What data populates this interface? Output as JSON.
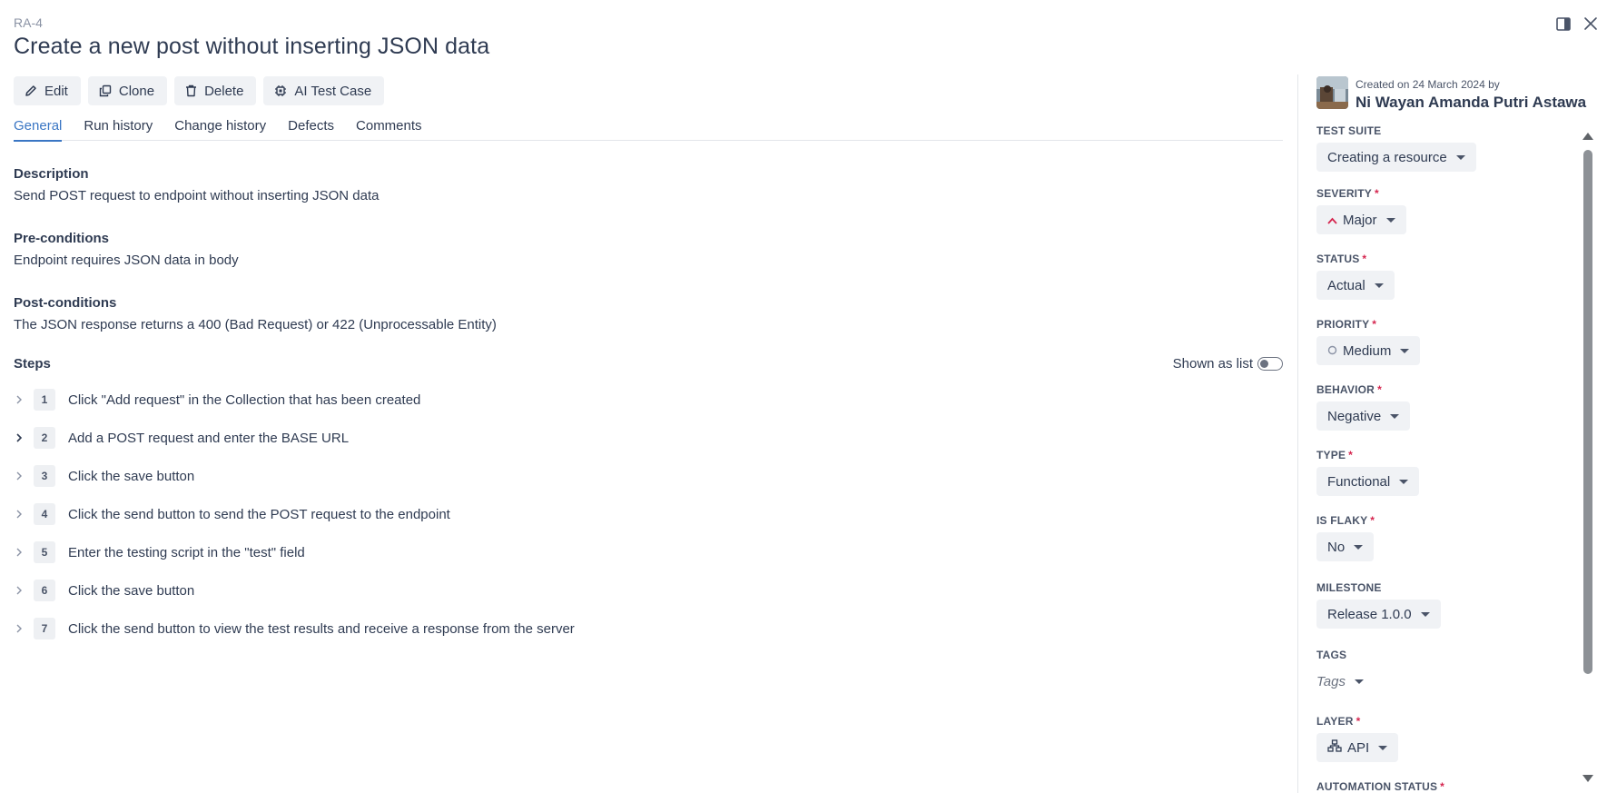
{
  "case": {
    "id": "RA-4",
    "title": "Create a new post without inserting JSON data"
  },
  "toolbar": {
    "edit_label": "Edit",
    "clone_label": "Clone",
    "delete_label": "Delete",
    "ai_label": "AI Test Case"
  },
  "tabs": [
    {
      "label": "General",
      "active": true
    },
    {
      "label": "Run history",
      "active": false
    },
    {
      "label": "Change history",
      "active": false
    },
    {
      "label": "Defects",
      "active": false
    },
    {
      "label": "Comments",
      "active": false
    }
  ],
  "description": {
    "label": "Description",
    "text": "Send POST request to endpoint without inserting JSON data"
  },
  "preconditions": {
    "label": "Pre-conditions",
    "text": "Endpoint requires JSON data in body"
  },
  "postconditions": {
    "label": "Post-conditions",
    "text": "The JSON response returns a 400 (Bad Request) or 422 (Unprocessable Entity)"
  },
  "steps": {
    "label": "Steps",
    "toggle_label": "Shown as list",
    "toggle_on": false,
    "items": [
      {
        "num": "1",
        "text": "Click \"Add request\" in the Collection that has been created"
      },
      {
        "num": "2",
        "text": "Add a POST request and enter the BASE URL"
      },
      {
        "num": "3",
        "text": "Click the save button"
      },
      {
        "num": "4",
        "text": "Click the send button to send the POST request to the endpoint"
      },
      {
        "num": "5",
        "text": "Enter the testing script in the \"test\" field"
      },
      {
        "num": "6",
        "text": "Click the save button"
      },
      {
        "num": "7",
        "text": "Click the send button to view the test results and receive a response from the server"
      }
    ]
  },
  "sidebar": {
    "created_line": "Created on 24 March 2024 by",
    "creator_name": "Ni Wayan Amanda Putri Astawa",
    "fields": {
      "test_suite": {
        "label": "TEST SUITE",
        "value": "Creating a resource",
        "required": false
      },
      "severity": {
        "label": "SEVERITY",
        "value": "Major",
        "required": true,
        "icon": "chevron-up-icon",
        "icon_color": "#d5264f"
      },
      "status": {
        "label": "STATUS",
        "value": "Actual",
        "required": true
      },
      "priority": {
        "label": "PRIORITY",
        "value": "Medium",
        "required": true,
        "icon": "circle-icon"
      },
      "behavior": {
        "label": "BEHAVIOR",
        "value": "Negative",
        "required": true
      },
      "type": {
        "label": "TYPE",
        "value": "Functional",
        "required": true
      },
      "is_flaky": {
        "label": "IS FLAKY",
        "value": "No",
        "required": true
      },
      "milestone": {
        "label": "MILESTONE",
        "value": "Release 1.0.0",
        "required": false
      },
      "tags": {
        "label": "TAGS",
        "value": "Tags",
        "required": false
      },
      "layer": {
        "label": "LAYER",
        "value": "API",
        "required": true,
        "icon": "network-icon"
      },
      "automation_status": {
        "label": "AUTOMATION STATUS",
        "required": true
      }
    }
  },
  "colors": {
    "accent": "#3a76c4",
    "required": "#d5264f",
    "text": "#2f3b52"
  }
}
